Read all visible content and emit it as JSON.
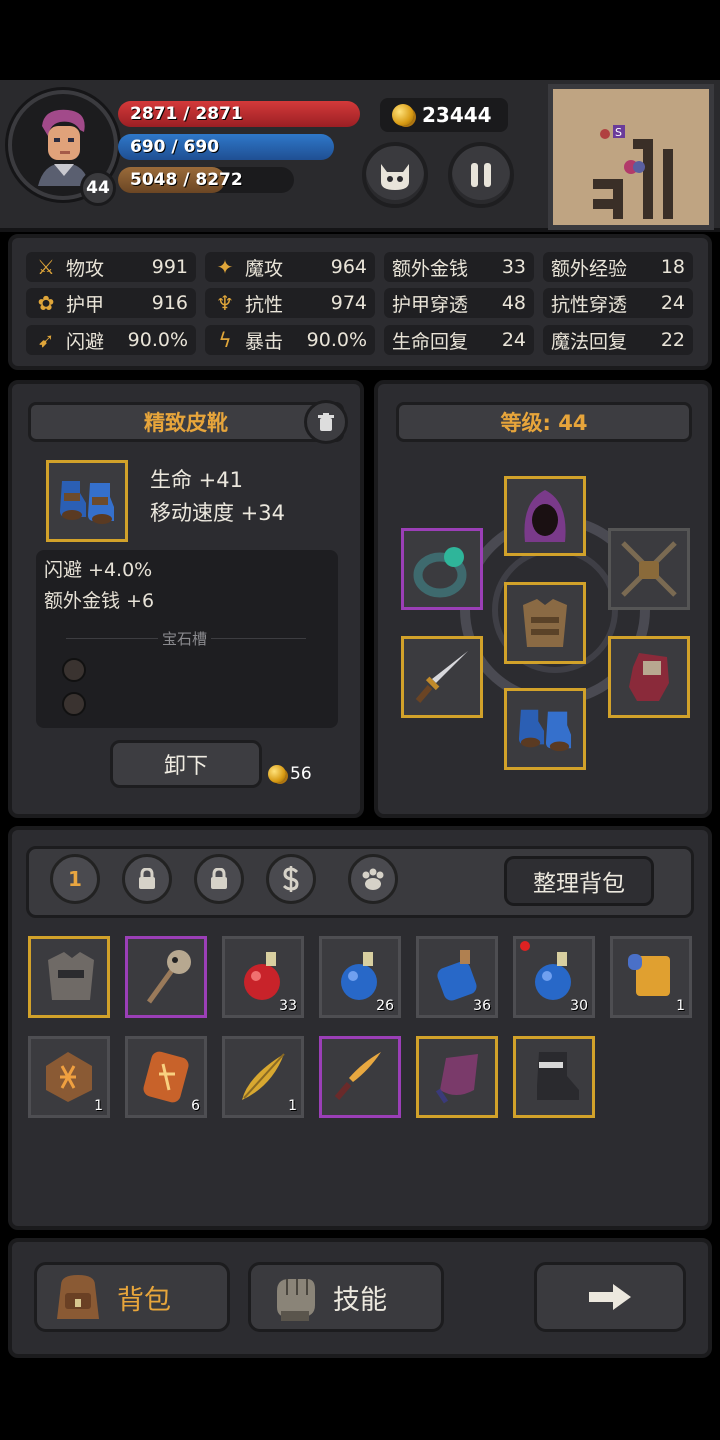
{
  "player": {
    "hp": "2871 / 2871",
    "mp": "690 / 690",
    "xp": "5048 / 8272",
    "xp_fraction": 0.61,
    "level": "44",
    "gold": "23444"
  },
  "minimap": {
    "marker": "S"
  },
  "stats": [
    {
      "label": "物攻",
      "value": "991",
      "icon": "sword-icon"
    },
    {
      "label": "魔攻",
      "value": "964",
      "icon": "magic-icon"
    },
    {
      "label": "额外金钱",
      "value": "33"
    },
    {
      "label": "额外经验",
      "value": "18"
    },
    {
      "label": "护甲",
      "value": "916",
      "icon": "paw-shield-icon"
    },
    {
      "label": "抗性",
      "value": "974",
      "icon": "resist-icon"
    },
    {
      "label": "护甲穿透",
      "value": "48"
    },
    {
      "label": "抗性穿透",
      "value": "24"
    },
    {
      "label": "闪避",
      "value": "90.0%",
      "icon": "dodge-icon"
    },
    {
      "label": "暴击",
      "value": "90.0%",
      "icon": "lightning-icon"
    },
    {
      "label": "生命回复",
      "value": "24"
    },
    {
      "label": "魔法回复",
      "value": "22"
    }
  ],
  "item": {
    "name": "精致皮靴",
    "main_stats": [
      "生命 +41",
      "移动速度 +34"
    ],
    "sub_stats": [
      "闪避 +4.0%",
      "额外金钱 +6"
    ],
    "gem_label": "宝石槽",
    "unequip_label": "卸下",
    "sell_price": "56"
  },
  "equipment": {
    "level_label": "等级: 44"
  },
  "inventory": {
    "tabs": [
      "1"
    ],
    "sort_label": "整理背包",
    "items": [
      {
        "icon": "armor-icon",
        "rarity": "gold",
        "qty": ""
      },
      {
        "icon": "staff-icon",
        "rarity": "purple",
        "qty": ""
      },
      {
        "icon": "red-potion-icon",
        "rarity": "grey",
        "qty": "33"
      },
      {
        "icon": "blue-potion-icon",
        "rarity": "grey",
        "qty": "26"
      },
      {
        "icon": "blue-flask-icon",
        "rarity": "grey",
        "qty": "36"
      },
      {
        "icon": "blue-potion-icon",
        "rarity": "grey",
        "qty": "30",
        "new": true
      },
      {
        "icon": "scroll-icon",
        "rarity": "grey",
        "qty": "1"
      },
      {
        "icon": "rune-stone-icon",
        "rarity": "grey",
        "qty": "1"
      },
      {
        "icon": "rune-tablet-icon",
        "rarity": "grey",
        "qty": "6"
      },
      {
        "icon": "feather-icon",
        "rarity": "grey",
        "qty": "1"
      },
      {
        "icon": "dagger-icon",
        "rarity": "purple",
        "qty": ""
      },
      {
        "icon": "cloak-icon",
        "rarity": "gold",
        "qty": ""
      },
      {
        "icon": "boots-icon",
        "rarity": "gold",
        "qty": ""
      }
    ]
  },
  "nav": {
    "bag_label": "背包",
    "skills_label": "技能"
  },
  "colors": {
    "accent_gold": "#e7a53b",
    "rarity_gold": "#d2a22a",
    "rarity_purple": "#9b3fb7",
    "hp": "#c83030",
    "mp": "#2f6cb8"
  }
}
